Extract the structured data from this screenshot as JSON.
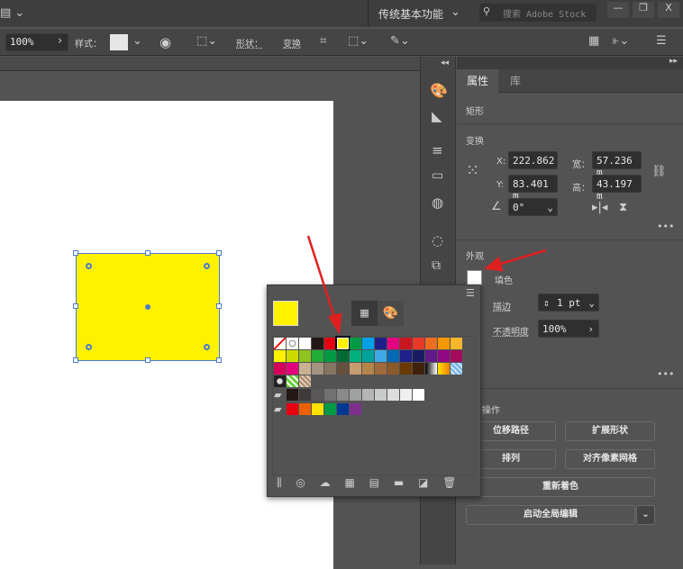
{
  "topbar": {
    "workspace": "传统基本功能",
    "search_placeholder": "搜索 Adobe Stock",
    "minimize": "—",
    "restore": "❐",
    "close": "X"
  },
  "toolbar": {
    "zoom": "100%",
    "style_label": "样式：",
    "shape_label": "形状：",
    "transform_label": "变换"
  },
  "panel": {
    "tabs": [
      "属性",
      "库"
    ],
    "object_type": "矩形",
    "transform_title": "变换",
    "x_label": "X:",
    "x": "222.862",
    "y_label": "Y:",
    "y": "83.401 m",
    "w_label": "宽：",
    "w": "57.236 m",
    "h_label": "高：",
    "h": "43.197 m",
    "angle": "0°",
    "more": "•••",
    "appearance_title": "外观",
    "fill_label": "填色",
    "stroke_label": "描边",
    "stroke_value": "1 pt",
    "opacity_label": "不透明度",
    "opacity_value": "100%",
    "quick_actions_title": "操作",
    "buttons": {
      "offset_path": "位移路径",
      "expand_shape": "扩展形状",
      "arrange": "排列",
      "align_pixel": "对齐像素网格",
      "recolor": "重新着色",
      "global_edit": "启动全局编辑"
    }
  },
  "swatches": {
    "current_fill": "#fff200",
    "row1": [
      "none",
      "registration",
      "#ffffff",
      "#231815",
      "#e60012",
      "#fff100",
      "#009944",
      "#00a0e9",
      "#1d2088",
      "#e4007f",
      "#c9161d",
      "#e83828",
      "#ed6d1f",
      "#f39800",
      "#f8b62d"
    ],
    "row2": [
      "#fff100",
      "#cfdb00",
      "#8fc31f",
      "#22ac38",
      "#009944",
      "#006934",
      "#00b07a",
      "#00a29a",
      "#3fa9e6",
      "#0068b7",
      "#1d2088",
      "#171c61",
      "#601986",
      "#920783",
      "#a40b5d"
    ],
    "row3": [
      "#d6005a",
      "#e4007f",
      "#c8b292",
      "#a59481",
      "#857563",
      "#64503d",
      "#c69c6d",
      "#b5844c",
      "#a16a3b",
      "#8c5a2a",
      "#6a3906",
      "#42210b",
      "gradient-bw",
      "gradient-yellow",
      "pattern-blue"
    ],
    "row4": [
      "pattern-dots",
      "pattern-green",
      "pattern-brown"
    ],
    "grays": [
      "#231815",
      "#3e3a39",
      "#595757",
      "#727171",
      "#898989",
      "#9fa0a0",
      "#b5b5b6",
      "#c9caca",
      "#dcdddd",
      "#efefef",
      "#ffffff"
    ],
    "brights": [
      "#e60012",
      "#eb6100",
      "#ffe100",
      "#009944",
      "#003894",
      "#7d2f8e"
    ]
  },
  "canvas": {
    "rect_fill": "#fff200",
    "arrow_color": "#e02020"
  }
}
